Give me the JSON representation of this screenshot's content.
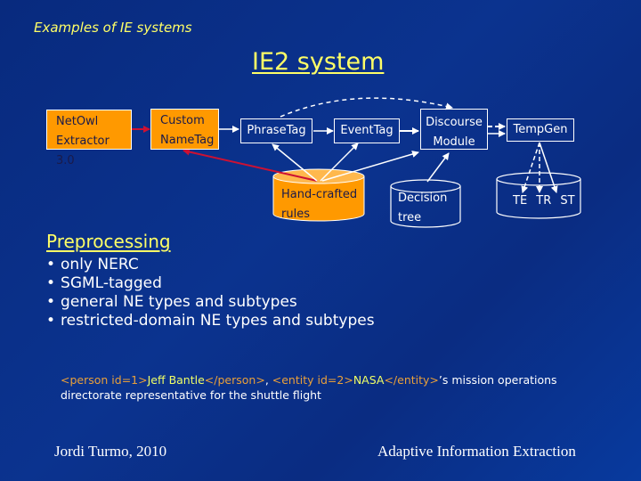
{
  "slide": {
    "section_title": "Examples of IE systems",
    "title": "IE2 system"
  },
  "diagram": {
    "nodes": {
      "netowl": {
        "line1": "NetOwl",
        "line2": "Extractor 3.0",
        "style": "orange-box"
      },
      "custom_nametag": {
        "line1": "Custom",
        "line2": "NameTag",
        "style": "orange-box"
      },
      "phrasetag": {
        "label": "PhraseTag",
        "style": "outline-box"
      },
      "eventtag": {
        "label": "EventTag",
        "style": "outline-box"
      },
      "discourse": {
        "line1": "Discourse",
        "line2": "Module",
        "style": "outline-box"
      },
      "tempgen": {
        "label": "TempGen",
        "style": "outline-box"
      },
      "handcrafted": {
        "line1": "Hand-crafted",
        "line2": "rules",
        "style": "orange-cylinder"
      },
      "decision_tree": {
        "line1": "Decision",
        "line2": "tree",
        "style": "outline-cylinder"
      },
      "outputs": {
        "labels": [
          "TE",
          "TR",
          "ST"
        ],
        "style": "outline-cylinder"
      }
    },
    "edges": [
      {
        "from": "netowl",
        "to": "custom_nametag",
        "color": "red",
        "dashed": false
      },
      {
        "from": "custom_nametag",
        "to": "phrasetag",
        "color": "white",
        "dashed": false
      },
      {
        "from": "phrasetag",
        "to": "eventtag",
        "color": "white",
        "dashed": false
      },
      {
        "from": "eventtag",
        "to": "discourse",
        "color": "white",
        "dashed": false
      },
      {
        "from": "phrasetag",
        "to": "discourse",
        "color": "white",
        "dashed": true
      },
      {
        "from": "discourse",
        "to": "tempgen",
        "color": "white",
        "dashed": true
      },
      {
        "from": "discourse",
        "to": "tempgen",
        "color": "white",
        "dashed": false
      },
      {
        "from": "handcrafted",
        "to": "custom_nametag",
        "color": "red",
        "dashed": false
      },
      {
        "from": "handcrafted",
        "to": "phrasetag",
        "color": "white",
        "dashed": false
      },
      {
        "from": "handcrafted",
        "to": "eventtag",
        "color": "white",
        "dashed": false
      },
      {
        "from": "handcrafted",
        "to": "discourse",
        "color": "white",
        "dashed": false
      },
      {
        "from": "decision_tree",
        "to": "discourse",
        "color": "white",
        "dashed": false
      },
      {
        "from": "tempgen",
        "to": "TE",
        "color": "white",
        "dashed": true
      },
      {
        "from": "tempgen",
        "to": "TR",
        "color": "white",
        "dashed": true
      },
      {
        "from": "tempgen",
        "to": "ST",
        "color": "white",
        "dashed": false
      }
    ]
  },
  "preprocessing": {
    "title": "Preprocessing",
    "bullets": [
      "only NERC",
      "SGML-tagged",
      "general NE types and subtypes",
      "restricted-domain NE types and subtypes"
    ]
  },
  "example": {
    "t1": "<person id=1>",
    "e1": "Jeff Bantle",
    "t2": "</person>",
    "s1": ", ",
    "t3": "<entity id=2>",
    "e2": "NASA",
    "t4": "</entity>",
    "s2": "’s mission operations directorate representative for the shuttle flight"
  },
  "colors": {
    "background": "#0a2f86",
    "title_yellow": "#ffff66",
    "box_orange": "#ff9900",
    "tag_orange": "#e9a03a",
    "entity_yellow": "#f0ff66",
    "arrow_red": "#cc1133",
    "arrow_white": "#ffffff"
  },
  "footer": {
    "author": "Jordi Turmo, 2010",
    "course": "Adaptive Information Extraction"
  }
}
